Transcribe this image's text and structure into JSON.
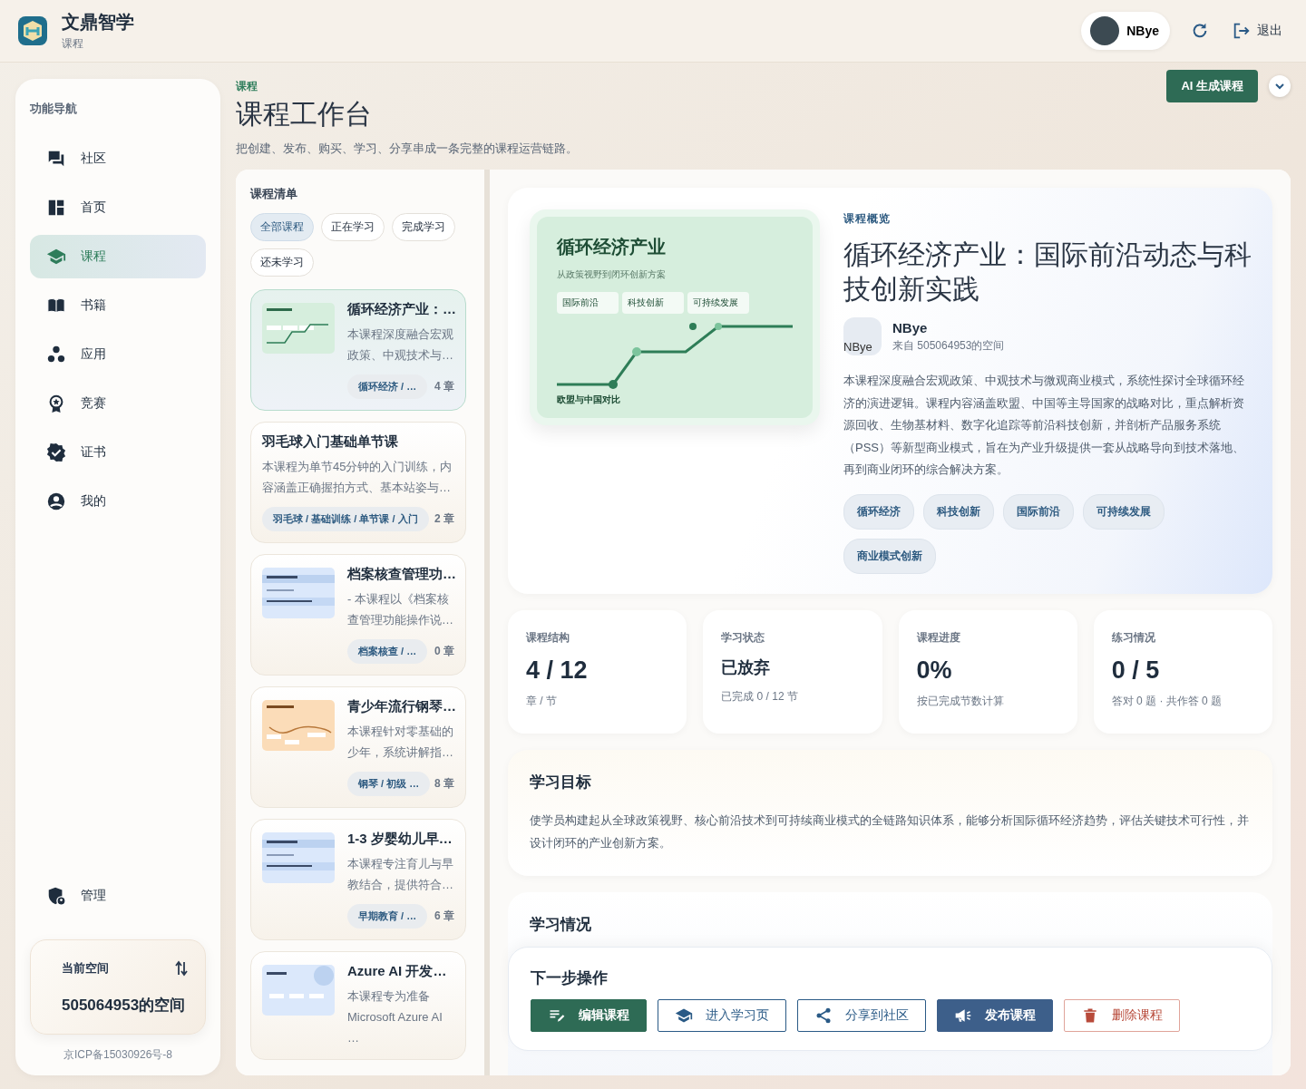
{
  "header": {
    "app_name": "文鼎智学",
    "subtitle": "课程",
    "user": {
      "name": "NBye"
    },
    "logout": "退出"
  },
  "sidebar": {
    "title": "功能导航",
    "items": [
      {
        "label": "社区",
        "selected": false
      },
      {
        "label": "首页",
        "selected": false
      },
      {
        "label": "课程",
        "selected": true
      },
      {
        "label": "书籍",
        "selected": false
      },
      {
        "label": "应用",
        "selected": false
      },
      {
        "label": "竞赛",
        "selected": false
      },
      {
        "label": "证书",
        "selected": false
      },
      {
        "label": "我的",
        "selected": false
      }
    ],
    "admin": {
      "label": "管理"
    },
    "space": {
      "label": "当前空间",
      "name": "505064953的空间"
    },
    "footer": "京ICP备15030926号-8"
  },
  "page": {
    "eyebrow": "课程",
    "title": "课程工作台",
    "subtitle": "把创建、发布、购买、学习、分享串成一条完整的课程运营链路。",
    "generate_button": "AI 生成课程"
  },
  "course_list": {
    "title": "课程清单",
    "filters": [
      {
        "label": "全部课程",
        "selected": true
      },
      {
        "label": "正在学习",
        "selected": false
      },
      {
        "label": "完成学习",
        "selected": false
      },
      {
        "label": "还未学习",
        "selected": false
      }
    ],
    "courses": [
      {
        "title": "循环经济产业：…",
        "description": "本课程深度融合宏观政策、中观技术与…",
        "tag": "循环经济 / …",
        "chapters": "4 章",
        "selected": true
      },
      {
        "title": "羽毛球入门基础单节课",
        "description": "本课程为单节45分钟的入门训练，内容涵盖正确握拍方式、基本站姿与…",
        "tag": "羽毛球 / 基础训练 / 单节课 / 入门",
        "chapters": "2 章",
        "selected": false
      },
      {
        "title": "档案核查管理功…",
        "description": "- 本课程以《档案核查管理功能操作说…",
        "tag": "档案核查 / …",
        "chapters": "0 章",
        "selected": false
      },
      {
        "title": "青少年流行钢琴…",
        "description": "本课程针对零基础的少年，系统讲解指…",
        "tag": "钢琴 / 初级 …",
        "chapters": "8 章",
        "selected": false
      },
      {
        "title": "1-3 岁婴幼儿早…",
        "description": "本课程专注育儿与早教结合，提供符合…",
        "tag": "早期教育 / …",
        "chapters": "6 章",
        "selected": false
      },
      {
        "title": "Azure AI 开发…",
        "description": "本课程专为准备 Microsoft Azure AI …",
        "selected": false
      }
    ]
  },
  "detail": {
    "cover": {
      "title": "循环经济产业",
      "subtitle": "从政策视野到闭环创新方案",
      "labels": [
        "国际前沿",
        "科技创新",
        "可持续发展"
      ],
      "caption": "欧盟与中国对比"
    },
    "eyebrow": "课程概览",
    "title": "循环经济产业：国际前沿动态与科技创新实践",
    "author": {
      "avatar_alt": "NBye",
      "name": "NBye",
      "source": "来自 505064953的空间"
    },
    "description": "本课程深度融合宏观政策、中观技术与微观商业模式，系统性探讨全球循环经济的演进逻辑。课程内容涵盖欧盟、中国等主导国家的战略对比，重点解析资源回收、生物基材料、数字化追踪等前沿科技创新，并剖析产品服务系统（PSS）等新型商业模式，旨在为产业升级提供一套从战略导向到技术落地、再到商业闭环的综合解决方案。",
    "tags": [
      "循环经济",
      "科技创新",
      "国际前沿",
      "可持续发展",
      "商业模式创新"
    ]
  },
  "stats": [
    {
      "label": "课程结构",
      "value": "4 / 12",
      "note": "章 / 节",
      "kind": "big"
    },
    {
      "label": "学习状态",
      "value": "已放弃",
      "note": "已完成 0 / 12 节",
      "kind": "status"
    },
    {
      "label": "课程进度",
      "value": "0%",
      "note": "按已完成节数计算",
      "kind": "big"
    },
    {
      "label": "练习情况",
      "value": "0 / 5",
      "note": "答对 0 题 · 共作答 0 题",
      "kind": "big"
    }
  ],
  "goal": {
    "title": "学习目标",
    "text": "使学员构建起从全球政策视野、核心前沿技术到可持续商业模式的全链路知识体系，能够分析国际循环经济趋势，评估关键技术可行性，并设计闭环的产业创新方案。"
  },
  "learning": {
    "title": "学习情况"
  },
  "next_steps": {
    "title": "下一步操作",
    "actions": [
      {
        "label": "编辑课程",
        "kind": "primary"
      },
      {
        "label": "进入学习页",
        "kind": "outline"
      },
      {
        "label": "分享到社区",
        "kind": "outline"
      },
      {
        "label": "发布课程",
        "kind": "publish"
      },
      {
        "label": "删除课程",
        "kind": "danger"
      }
    ]
  }
}
